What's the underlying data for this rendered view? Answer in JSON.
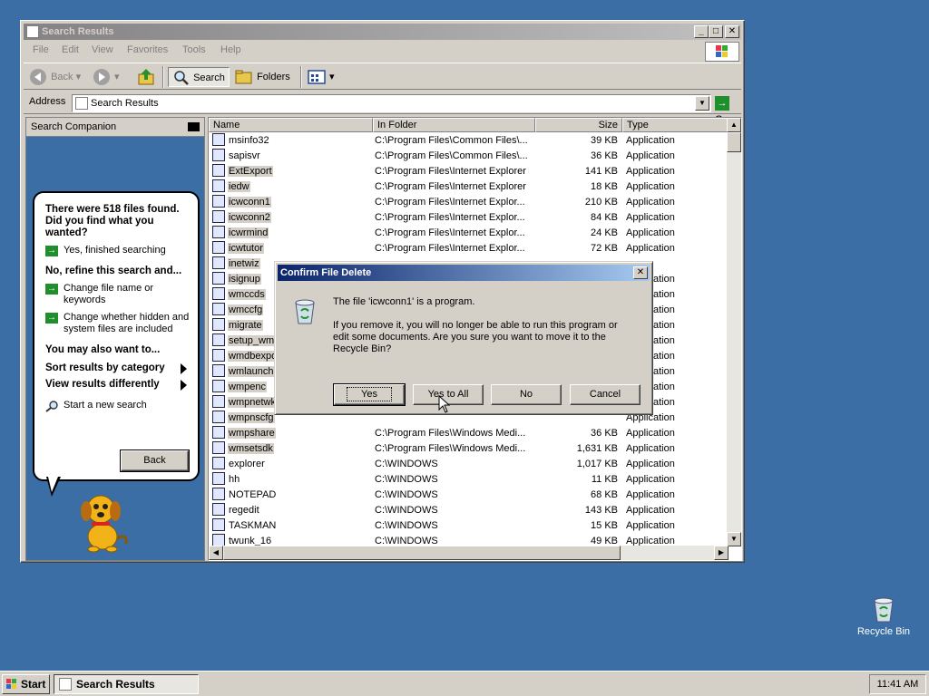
{
  "window": {
    "title": "Search Results",
    "menu": [
      "File",
      "Edit",
      "View",
      "Favorites",
      "Tools",
      "Help"
    ],
    "toolbar": {
      "back": "Back",
      "search": "Search",
      "folders": "Folders"
    },
    "address": {
      "label": "Address",
      "value": "Search Results",
      "go": "Go"
    }
  },
  "companion": {
    "header": "Search Companion",
    "found": "There were 518 files found. Did you find what you wanted?",
    "yes_finished": "Yes, finished searching",
    "refine_heading": "No, refine this search and...",
    "change_name": "Change file name or keywords",
    "change_hidden": "Change whether hidden and system files are included",
    "also_heading": "You may also want to...",
    "sort_results": "Sort results by category",
    "view_results": "View results differently",
    "new_search": "Start a new search",
    "back": "Back"
  },
  "columns": {
    "name": "Name",
    "folder": "In Folder",
    "size": "Size",
    "type": "Type"
  },
  "files": [
    {
      "name": "msinfo32",
      "folder": "C:\\Program Files\\Common Files\\...",
      "size": "39 KB",
      "type": "Application"
    },
    {
      "name": "sapisvr",
      "folder": "C:\\Program Files\\Common Files\\...",
      "size": "36 KB",
      "type": "Application"
    },
    {
      "name": "ExtExport",
      "folder": "C:\\Program Files\\Internet Explorer",
      "size": "141 KB",
      "type": "Application"
    },
    {
      "name": "iedw",
      "folder": "C:\\Program Files\\Internet Explorer",
      "size": "18 KB",
      "type": "Application"
    },
    {
      "name": "icwconn1",
      "folder": "C:\\Program Files\\Internet Explor...",
      "size": "210 KB",
      "type": "Application"
    },
    {
      "name": "icwconn2",
      "folder": "C:\\Program Files\\Internet Explor...",
      "size": "84 KB",
      "type": "Application"
    },
    {
      "name": "icwrmind",
      "folder": "C:\\Program Files\\Internet Explor...",
      "size": "24 KB",
      "type": "Application"
    },
    {
      "name": "icwtutor",
      "folder": "C:\\Program Files\\Internet Explor...",
      "size": "72 KB",
      "type": "Application"
    },
    {
      "name": "inetwiz",
      "folder": "",
      "size": "",
      "type": ""
    },
    {
      "name": "isignup",
      "folder": "",
      "size": "",
      "type": "Application"
    },
    {
      "name": "wmccds",
      "folder": "",
      "size": "",
      "type": "Application"
    },
    {
      "name": "wmccfg",
      "folder": "",
      "size": "",
      "type": "Application"
    },
    {
      "name": "migrate",
      "folder": "",
      "size": "",
      "type": "Application"
    },
    {
      "name": "setup_wm",
      "folder": "",
      "size": "",
      "type": "Application"
    },
    {
      "name": "wmdbexpo",
      "folder": "",
      "size": "",
      "type": "Application"
    },
    {
      "name": "wmlaunch",
      "folder": "",
      "size": "",
      "type": "Application"
    },
    {
      "name": "wmpenc",
      "folder": "",
      "size": "",
      "type": "Application"
    },
    {
      "name": "wmpnetwk",
      "folder": "",
      "size": "",
      "type": "Application"
    },
    {
      "name": "wmpnscfg",
      "folder": "",
      "size": "",
      "type": "Application"
    },
    {
      "name": "wmpshare",
      "folder": "C:\\Program Files\\Windows Medi...",
      "size": "36 KB",
      "type": "Application"
    },
    {
      "name": "wmsetsdk",
      "folder": "C:\\Program Files\\Windows Medi...",
      "size": "1,631 KB",
      "type": "Application"
    },
    {
      "name": "explorer",
      "folder": "C:\\WINDOWS",
      "size": "1,017 KB",
      "type": "Application"
    },
    {
      "name": "hh",
      "folder": "C:\\WINDOWS",
      "size": "11 KB",
      "type": "Application"
    },
    {
      "name": "NOTEPAD",
      "folder": "C:\\WINDOWS",
      "size": "68 KB",
      "type": "Application"
    },
    {
      "name": "regedit",
      "folder": "C:\\WINDOWS",
      "size": "143 KB",
      "type": "Application"
    },
    {
      "name": "TASKMAN",
      "folder": "C:\\WINDOWS",
      "size": "15 KB",
      "type": "Application"
    },
    {
      "name": "twunk_16",
      "folder": "C:\\WINDOWS",
      "size": "49 KB",
      "type": "Application"
    }
  ],
  "dialog": {
    "title": "Confirm File Delete",
    "line1": "The file 'icwconn1' is a program.",
    "line2": "If you remove it, you will no longer be able to run this program or edit some documents. Are you sure you want to move it to the Recycle Bin?",
    "yes": "Yes",
    "yes_all": "Yes to All",
    "no": "No",
    "cancel": "Cancel"
  },
  "desktop": {
    "recycle_bin": "Recycle Bin"
  },
  "taskbar": {
    "start": "Start",
    "task": "Search Results",
    "clock": "11:41 AM"
  }
}
